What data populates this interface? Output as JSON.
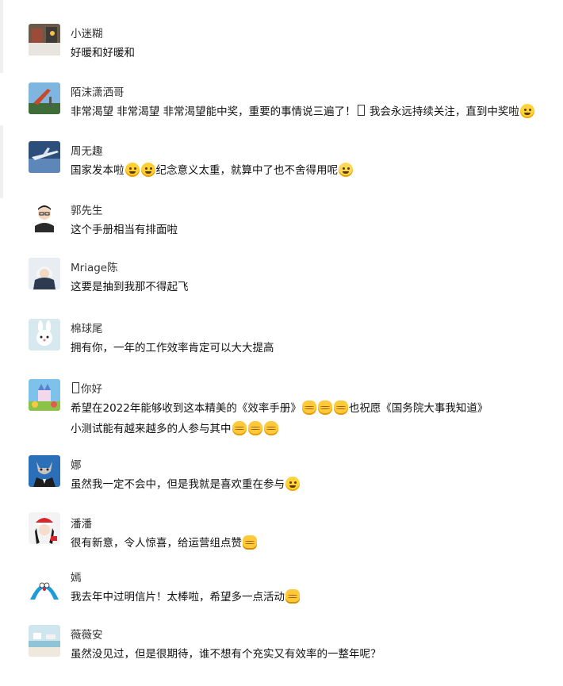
{
  "comments": [
    {
      "name": "小迷糊",
      "avatar_icon": "snowy-street-photo-icon",
      "lines": [
        [
          {
            "t": "text",
            "v": "好暖和好暖和"
          }
        ]
      ]
    },
    {
      "name": "陌沫潇洒哥",
      "avatar_icon": "rocket-sky-photo-icon",
      "lines": [
        [
          {
            "t": "text",
            "v": "非常渴望 非常渴望 非常渴望能中奖，重要的事情说三遍了！"
          },
          {
            "t": "box"
          },
          {
            "t": "text",
            "v": " 我会永远持续关注，直到中奖啦"
          },
          {
            "t": "emoji",
            "v": "smile-emoji"
          }
        ]
      ]
    },
    {
      "name": "周无趣",
      "avatar_icon": "airplane-photo-icon",
      "lines": [
        [
          {
            "t": "text",
            "v": "国家发本啦"
          },
          {
            "t": "emoji",
            "v": "grin-emoji"
          },
          {
            "t": "emoji",
            "v": "grin-emoji"
          },
          {
            "t": "text",
            "v": "纪念意义太重，就算中了也不舍得用呢"
          },
          {
            "t": "emoji",
            "v": "cold-emoji"
          }
        ]
      ]
    },
    {
      "name": "郭先生",
      "avatar_icon": "cartoon-man-glasses-icon",
      "lines": [
        [
          {
            "t": "text",
            "v": "这个手册相当有排面啦"
          }
        ]
      ]
    },
    {
      "name": "Mriage陈",
      "avatar_icon": "anime-character-icon",
      "lines": [
        [
          {
            "t": "text",
            "v": "这要是抽到我那不得起飞"
          }
        ]
      ]
    },
    {
      "name": "棉球尾",
      "avatar_icon": "rabbit-cartoon-icon",
      "lines": [
        [
          {
            "t": "text",
            "v": "拥有你，一年的工作效率肯定可以大大提高"
          }
        ]
      ]
    },
    {
      "name": "你好",
      "name_prefix_box": true,
      "avatar_icon": "cartoon-castle-icon",
      "lines": [
        [
          {
            "t": "text",
            "v": "希望在2022年能够收到这本精美的《效率手册》"
          },
          {
            "t": "emoji",
            "v": "fist-emoji"
          },
          {
            "t": "emoji",
            "v": "fist-emoji"
          },
          {
            "t": "emoji",
            "v": "fist-emoji"
          },
          {
            "t": "text",
            "v": "也祝愿《国务院大事我知道》"
          }
        ],
        [
          {
            "t": "text",
            "v": "小测试能有越来越多的人参与其中"
          },
          {
            "t": "emoji",
            "v": "clap-emoji"
          },
          {
            "t": "emoji",
            "v": "clap-emoji"
          },
          {
            "t": "emoji",
            "v": "clap-emoji"
          }
        ]
      ]
    },
    {
      "name": "娜",
      "avatar_icon": "cat-in-suit-icon",
      "lines": [
        [
          {
            "t": "text",
            "v": "虽然我一定不会中，但是我就是喜欢重在参与"
          },
          {
            "t": "emoji",
            "v": "tongue-emoji"
          }
        ]
      ]
    },
    {
      "name": "潘潘",
      "avatar_icon": "girl-santa-hat-icon",
      "lines": [
        [
          {
            "t": "text",
            "v": "很有新意，令人惊喜，给运营组点赞"
          },
          {
            "t": "emoji",
            "v": "thumbs-up-emoji"
          }
        ]
      ]
    },
    {
      "name": "嫣",
      "avatar_icon": "doraemon-icon",
      "lines": [
        [
          {
            "t": "text",
            "v": "我去年中过明信片！太棒啦，希望多一点活动"
          },
          {
            "t": "emoji",
            "v": "thumbs-up-emoji"
          }
        ]
      ]
    },
    {
      "name": "薇薇安",
      "avatar_icon": "seaside-photo-icon",
      "lines": [
        [
          {
            "t": "text",
            "v": "虽然没见过，但是很期待，谁不想有个充实又有效率的一整年呢？"
          }
        ]
      ]
    }
  ]
}
